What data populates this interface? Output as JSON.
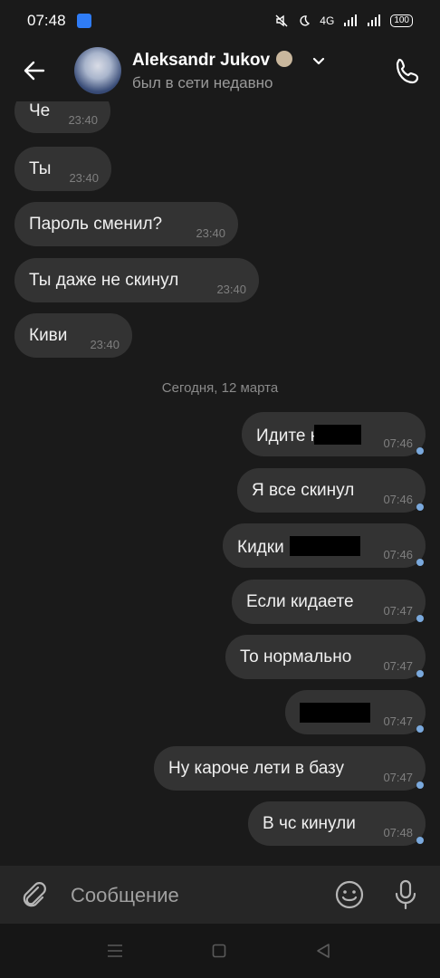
{
  "status_bar": {
    "time": "07:48",
    "network": "4G",
    "battery": "100"
  },
  "header": {
    "name": "Aleksandr Jukov",
    "status": "был в сети недавно"
  },
  "messages_before": [
    {
      "text": "Че",
      "time": "23:40"
    },
    {
      "text": "Ты",
      "time": "23:40"
    },
    {
      "text": "Пароль сменил?",
      "time": "23:40"
    },
    {
      "text": "Ты даже не скинул",
      "time": "23:40"
    },
    {
      "text": "Киви",
      "time": "23:40"
    }
  ],
  "date_separator": "Сегодня, 12 марта",
  "messages_after": [
    {
      "text": "Идите н",
      "time": "07:46"
    },
    {
      "text": "Я все скинул",
      "time": "07:46"
    },
    {
      "text": "Кидки",
      "time": "07:46"
    },
    {
      "text": "Если кидаете",
      "time": "07:47"
    },
    {
      "text": "То нормально",
      "time": "07:47"
    },
    {
      "text": "",
      "time": "07:47"
    },
    {
      "text": "Ну кароче лети в базу",
      "time": "07:47"
    },
    {
      "text": "В чс кинули",
      "time": "07:48"
    }
  ],
  "composer": {
    "placeholder": "Сообщение"
  },
  "icons": {
    "back": "arrow-left-icon",
    "phone": "phone-icon",
    "attach": "paperclip-icon",
    "emoji": "smiley-icon",
    "mic": "microphone-icon"
  },
  "colors": {
    "bubble": "#333333",
    "background": "#1a1a1a",
    "read": "#7aa9dd"
  }
}
